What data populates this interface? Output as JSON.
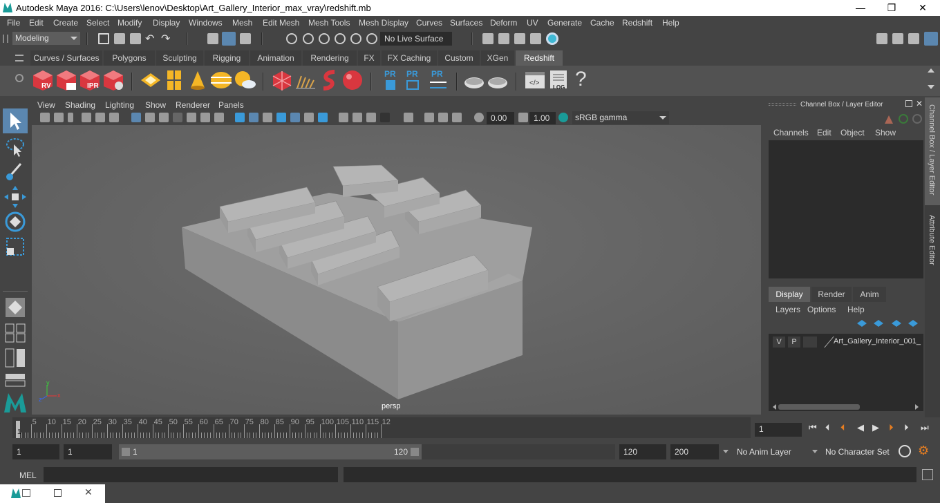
{
  "window": {
    "title": "Autodesk Maya 2016: C:\\Users\\lenov\\Desktop\\Art_Gallery_Interior_max_vray\\redshift.mb",
    "minimize": "—",
    "maximize": "❐",
    "close": "✕"
  },
  "menubar": [
    "File",
    "Edit",
    "Create",
    "Select",
    "Modify",
    "Display",
    "Windows",
    "Mesh",
    "Edit Mesh",
    "Mesh Tools",
    "Mesh Display",
    "Curves",
    "Surfaces",
    "Deform",
    "UV",
    "Generate",
    "Cache",
    "Redshift",
    "Help"
  ],
  "statusline": {
    "mode": "Modeling",
    "live_surface": "No Live Surface"
  },
  "shelf": {
    "tabs": [
      "Curves / Surfaces",
      "Polygons",
      "Sculpting",
      "Rigging",
      "Animation",
      "Rendering",
      "FX",
      "FX Caching",
      "Custom",
      "XGen",
      "Redshift"
    ],
    "active_tab": "Redshift",
    "icon_labels": {
      "rv": "RV",
      "ipr": "IPR",
      "pr1": "PR",
      "pr2": "PR",
      "pr3": "PR",
      "log": "LOG",
      "help": "?"
    }
  },
  "viewport": {
    "menu": [
      "View",
      "Shading",
      "Lighting",
      "Show",
      "Renderer",
      "Panels"
    ],
    "exposure": "0.00",
    "gamma": "1.00",
    "color_space": "sRGB gamma",
    "camera": "persp",
    "axis_x": "x",
    "axis_y": "y",
    "axis_z": "z"
  },
  "channel_box": {
    "title": "Channel Box / Layer Editor",
    "menu": [
      "Channels",
      "Edit",
      "Object",
      "Show"
    ],
    "layer_tabs": [
      "Display",
      "Render",
      "Anim"
    ],
    "active_layer_tab": "Display",
    "layer_menu": [
      "Layers",
      "Options",
      "Help"
    ],
    "layer": {
      "v": "V",
      "p": "P",
      "name": "Art_Gallery_Interior_001_"
    }
  },
  "side_tabs": [
    "Channel Box / Layer Editor",
    "Attribute Editor"
  ],
  "timeline": {
    "labels": [
      "5",
      "10",
      "15",
      "20",
      "25",
      "30",
      "35",
      "40",
      "45",
      "50",
      "55",
      "60",
      "65",
      "70",
      "75",
      "80",
      "85",
      "90",
      "95",
      "100",
      "105",
      "110",
      "115",
      "12"
    ],
    "current_frame_marker": "1",
    "current_frame": "1"
  },
  "range": {
    "start": "1",
    "playback_start": "1",
    "slider_start": "1",
    "slider_end": "120",
    "playback_end": "120",
    "end": "200",
    "anim_layer": "No Anim Layer",
    "character_set": "No Character Set"
  },
  "cmdline": {
    "label": "MEL"
  },
  "colors": {
    "accent": "#1a9b98",
    "panel": "#444444",
    "viewport_bg": "#6a6a6a",
    "active_tab": "#5d5d5d",
    "redshift_red": "#d9373f"
  }
}
